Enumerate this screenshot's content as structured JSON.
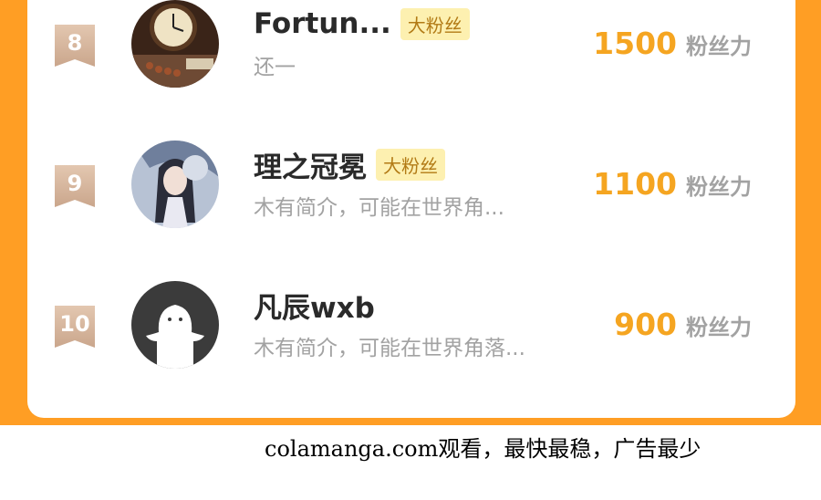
{
  "leaderboard": {
    "rows": [
      {
        "rank": "8",
        "name": "Fortun...",
        "badge": "大粉丝",
        "bio": "还一",
        "points": "1500",
        "unit": "粉丝力",
        "avatar": "clock-photo-avatar"
      },
      {
        "rank": "9",
        "name": "理之冠冕",
        "badge": "大粉丝",
        "bio": "木有简介，可能在世界角...",
        "points": "1100",
        "unit": "粉丝力",
        "avatar": "anime-girl-avatar"
      },
      {
        "rank": "10",
        "name": "凡辰wxb",
        "badge": "",
        "bio": "木有简介，可能在世界角落...",
        "points": "900",
        "unit": "粉丝力",
        "avatar": "default-user-avatar"
      }
    ]
  },
  "footer": {
    "watermark": "colamanga.com观看，最快最稳，广告最少"
  },
  "colors": {
    "frame": "#ff9e24",
    "points": "#f5a521",
    "badge_bg": "#fdf0b0",
    "badge_text": "#b27a15",
    "rank_ribbon": "#d9bba3"
  }
}
